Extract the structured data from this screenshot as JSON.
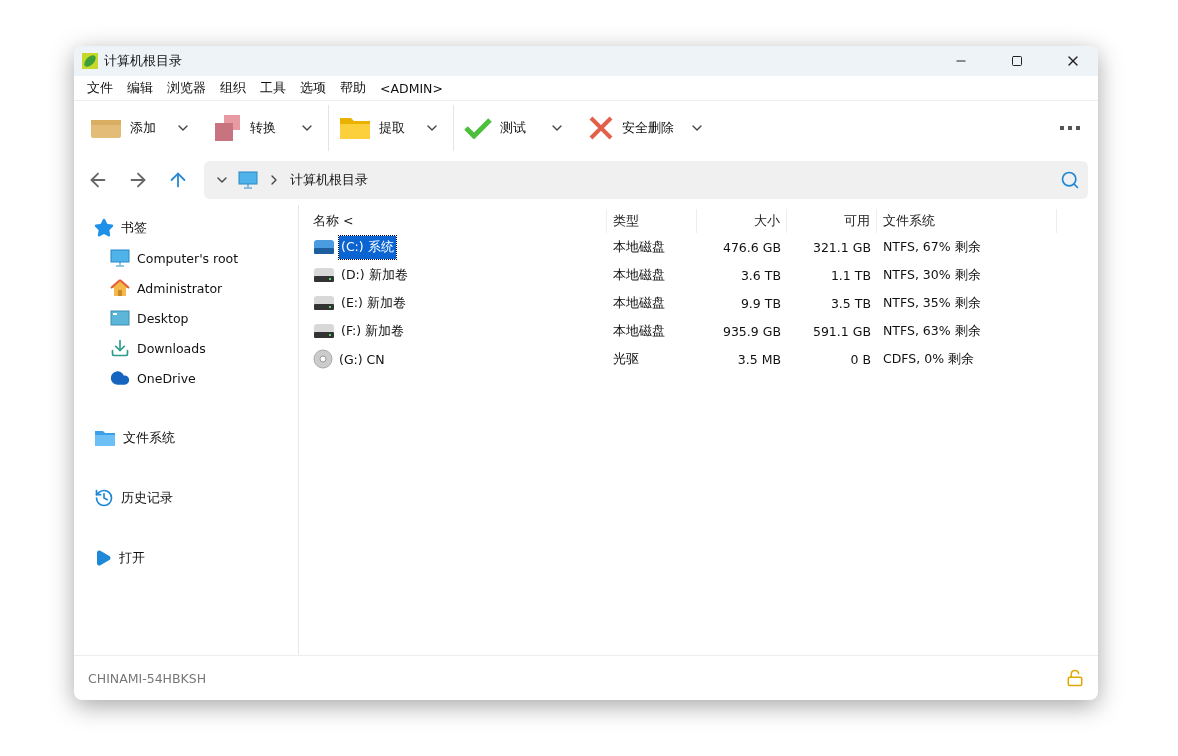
{
  "window": {
    "title": "计算机根目录"
  },
  "menu": [
    "文件",
    "编辑",
    "浏览器",
    "组织",
    "工具",
    "选项",
    "帮助",
    "<ADMIN>"
  ],
  "toolbar": [
    {
      "label": "添加",
      "kind": "box"
    },
    {
      "label": "转换",
      "kind": "squares"
    },
    {
      "label": "提取",
      "kind": "folder"
    },
    {
      "label": "测试",
      "kind": "check"
    },
    {
      "label": "安全删除",
      "kind": "cross"
    }
  ],
  "address": {
    "path": "计算机根目录"
  },
  "sidebar": [
    {
      "label": "书签",
      "kind": "star",
      "children": [
        {
          "label": "Computer's root",
          "kind": "monitor"
        },
        {
          "label": "Administrator",
          "kind": "home"
        },
        {
          "label": "Desktop",
          "kind": "desktop"
        },
        {
          "label": "Downloads",
          "kind": "download"
        },
        {
          "label": "OneDrive",
          "kind": "cloud"
        }
      ]
    },
    {
      "label": "文件系统",
      "kind": "folder"
    },
    {
      "label": "历史记录",
      "kind": "history"
    },
    {
      "label": "打开",
      "kind": "play"
    }
  ],
  "table": {
    "columns": [
      "名称 <",
      "类型",
      "大小",
      "可用",
      "文件系统"
    ],
    "rows": [
      {
        "kind": "system",
        "selected": true,
        "cells": [
          "(C:) 系统",
          "本地磁盘",
          "476.6 GB",
          "321.1 GB",
          "NTFS, 67% 剩余"
        ]
      },
      {
        "kind": "hdd",
        "selected": false,
        "cells": [
          "(D:) 新加卷",
          "本地磁盘",
          "3.6 TB",
          "1.1 TB",
          "NTFS, 30% 剩余"
        ]
      },
      {
        "kind": "hdd",
        "selected": false,
        "cells": [
          "(E:) 新加卷",
          "本地磁盘",
          "9.9 TB",
          "3.5 TB",
          "NTFS, 35% 剩余"
        ]
      },
      {
        "kind": "hdd",
        "selected": false,
        "cells": [
          "(F:) 新加卷",
          "本地磁盘",
          "935.9 GB",
          "591.1 GB",
          "NTFS, 63% 剩余"
        ]
      },
      {
        "kind": "cd",
        "selected": false,
        "cells": [
          "(G:) CN",
          "光驱",
          "3.5 MB",
          "0 B",
          "CDFS, 0% 剩余"
        ]
      }
    ]
  },
  "status_bar": {
    "computer": "CHINAMI-54HBKSH"
  }
}
